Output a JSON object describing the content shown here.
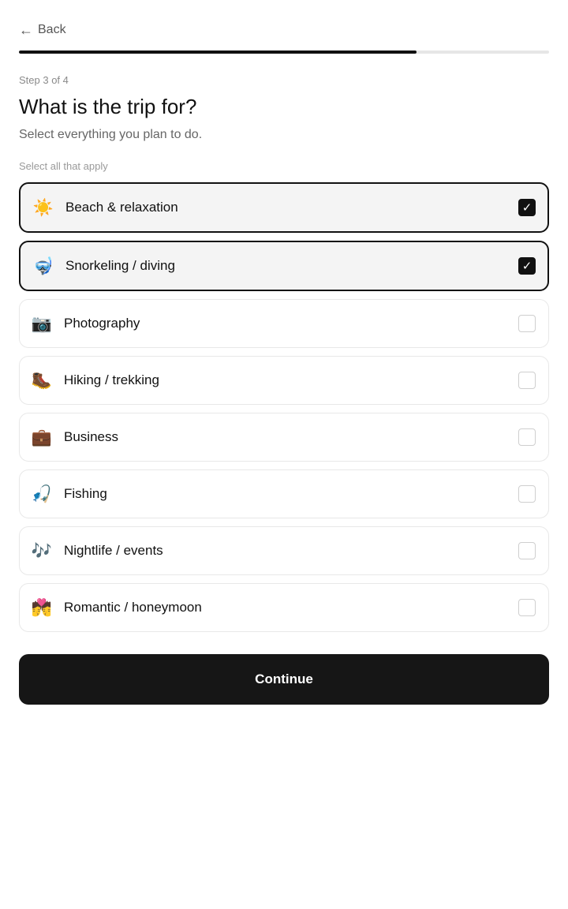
{
  "header": {
    "back_label": "Back",
    "back_icon": "arrow-left-icon",
    "progress_fraction": 0.75
  },
  "step_label": "Step 3 of 4",
  "title": "What is the trip for?",
  "subtitle": "Select everything you plan to do.",
  "hint": "Select all that apply",
  "options": [
    {
      "label": "Beach & relaxation",
      "emoji": "☀️",
      "icon": "sun-icon",
      "checked": true
    },
    {
      "label": "Snorkeling / diving",
      "emoji": "🤿",
      "icon": "diving-mask-icon",
      "checked": true
    },
    {
      "label": "Photography",
      "emoji": "📷",
      "icon": "camera-icon",
      "checked": false
    },
    {
      "label": "Hiking / trekking",
      "emoji": "🥾",
      "icon": "hiking-boot-icon",
      "checked": false
    },
    {
      "label": "Business",
      "emoji": "💼",
      "icon": "briefcase-icon",
      "checked": false
    },
    {
      "label": "Fishing",
      "emoji": "🎣",
      "icon": "fishing-pole-icon",
      "checked": false
    },
    {
      "label": "Nightlife / events",
      "emoji": "🎶",
      "icon": "music-notes-icon",
      "checked": false
    },
    {
      "label": "Romantic / honeymoon",
      "emoji": "💏",
      "icon": "couple-kiss-icon",
      "checked": false
    }
  ],
  "continue_label": "Continue",
  "colors": {
    "accent": "#111111",
    "selected_bg": "#f4f4f4",
    "border": "#e8e8e8"
  }
}
